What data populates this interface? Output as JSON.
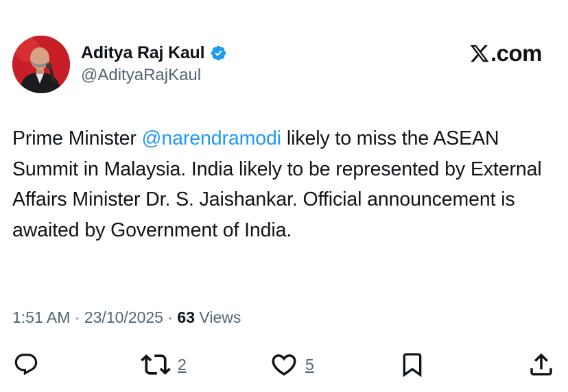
{
  "author": {
    "display_name": "Aditya Raj Kaul",
    "handle": "@AdityaRajKaul",
    "verified_icon": "verified-badge-icon",
    "verified_color": "#1d9bf0"
  },
  "brand": {
    "icon": "x-logo-icon",
    "text": ".com"
  },
  "tweet": {
    "text_before": "Prime Minister ",
    "mention": "@narendramodi",
    "text_after": " likely to miss the ASEAN Summit in Malaysia. India likely to be represented by External Affairs Minister Dr. S. Jaishankar. Official announcement is awaited by Government of India.",
    "mention_color": "#1d9bf0"
  },
  "meta": {
    "time": "1:51 AM",
    "separator": " · ",
    "date": "23/10/2025",
    "views_count": "63",
    "views_label": " Views"
  },
  "actions": {
    "reply": {
      "icon": "reply-icon"
    },
    "repost": {
      "icon": "repost-icon",
      "count": "2"
    },
    "like": {
      "icon": "heart-icon",
      "count": "5"
    },
    "bookmark": {
      "icon": "bookmark-icon"
    },
    "share": {
      "icon": "share-icon"
    }
  }
}
